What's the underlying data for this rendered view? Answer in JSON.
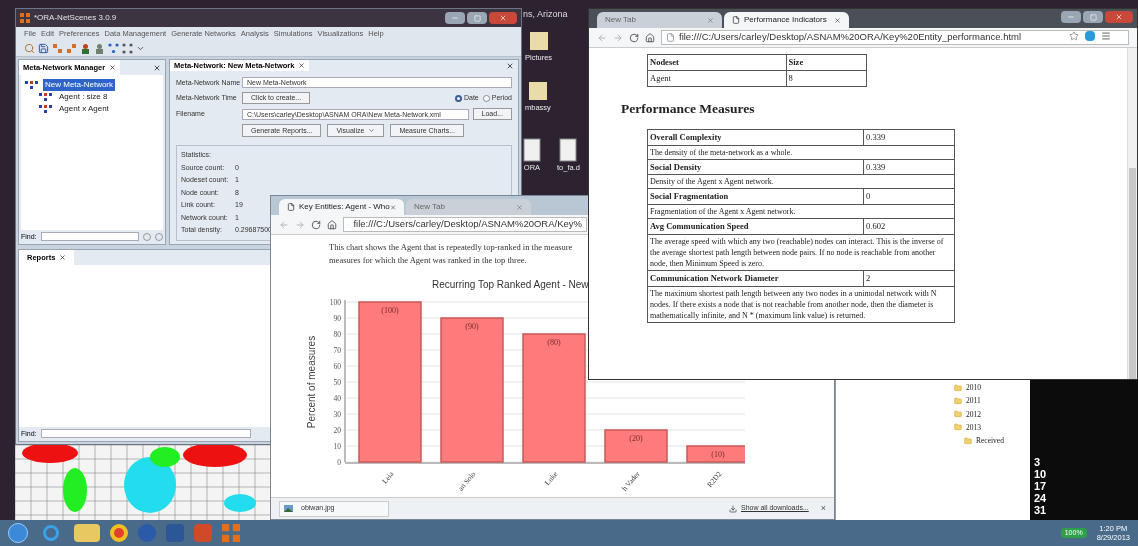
{
  "desktop": {
    "location_text": "ns, Arizona",
    "icons": [
      {
        "label": "Pictures"
      },
      {
        "label": "mbassy"
      },
      {
        "label": "ORA"
      },
      {
        "label": "to_fa.d"
      }
    ]
  },
  "ora_window": {
    "title": "*ORA-NetScenes 3.0.9",
    "menu": [
      "File",
      "Edit",
      "Preferences",
      "Data Management",
      "Generate Networks",
      "Analysis",
      "Simulations",
      "Visualizations",
      "Help"
    ],
    "manager_panel": {
      "tab": "Meta-Network Manager",
      "tree": [
        {
          "label": "New Meta-Network",
          "selected": true,
          "children": [
            {
              "label": "Agent : size 8",
              "selected": false
            },
            {
              "label": "Agent x Agent",
              "selected": false
            }
          ]
        }
      ],
      "find_label": "Find:"
    },
    "editor_panel": {
      "tab": "Meta-Network: New Meta-Network",
      "name_label": "Meta-Network Name",
      "name_value": "New Meta-Network",
      "time_label": "Meta-Network Time",
      "time_button": "Click to create...",
      "time_options": [
        {
          "label": "Date",
          "selected": true
        },
        {
          "label": "Period",
          "selected": false
        }
      ],
      "filename_label": "Filename",
      "filename_value": "C:\\Users\\carley\\Desktop\\ASNAM ORA\\New Meta-Network.xml",
      "load_button": "Load...",
      "actions": [
        "Generate Reports...",
        "Visualize",
        "Measure Charts..."
      ],
      "statistics_title": "Statistics:",
      "statistics": [
        {
          "label": "Source count:",
          "value": "0"
        },
        {
          "label": "Nodeset count:",
          "value": "1"
        },
        {
          "label": "Node count:",
          "value": "8"
        },
        {
          "label": "Link count:",
          "value": "19"
        },
        {
          "label": "Network count:",
          "value": "1"
        },
        {
          "label": "Total density:",
          "value": "0.29687500"
        }
      ]
    },
    "reports_panel": {
      "tab": "Reports",
      "find_label": "Find:"
    }
  },
  "key_entities_browser": {
    "tabs": [
      {
        "label": "Key Entities: Agent - Who",
        "selected": true
      },
      {
        "label": "New Tab",
        "selected": false
      }
    ],
    "url": "file:///C:/Users/carley/Desktop/ASNAM%20ORA/Key%",
    "intro": [
      "This chart shows the Agent that is repeatedly top-ranked in the measure",
      "measures for which the Agent was ranked in the top three."
    ],
    "chart_data": {
      "type": "bar",
      "title": "Recurring Top Ranked Agent - New",
      "ylabel": "Percent of measures",
      "categories": [
        "Leia",
        "an Solo",
        "Luke",
        "h Vader",
        "R2D2"
      ],
      "values": [
        100,
        90,
        80,
        20,
        10
      ],
      "ylim": [
        0,
        100
      ],
      "yticks": [
        0,
        10,
        20,
        30,
        40,
        50,
        60,
        70,
        80,
        90,
        100
      ],
      "grid": true,
      "value_labels": [
        "(100)",
        "(90)",
        "(80)",
        "(20)",
        "(10)"
      ]
    },
    "download": {
      "file": "obiwan.jpg",
      "show_all": "Show all downloads...",
      "close": "×"
    }
  },
  "performance_browser": {
    "tabs": [
      {
        "label": "New Tab",
        "selected": false
      },
      {
        "label": "Performance Indicators",
        "selected": true
      }
    ],
    "url": "file:///C:/Users/carley/Desktop/ASNAM%20ORA/Key%20Entity_performance.html",
    "nodeset_table": {
      "columns": [
        "Nodeset",
        "Size"
      ],
      "rows": [
        [
          "Agent",
          "8"
        ]
      ]
    },
    "heading": "Performance Measures",
    "measures": [
      {
        "name": "Overall Complexity",
        "value": "0.339",
        "description": "The density of the meta-network as a whole."
      },
      {
        "name": "Social Density",
        "value": "0.339",
        "description": "Density of the Agent x Agent network."
      },
      {
        "name": "Social Fragmentation",
        "value": "0",
        "description": "Fragmentation of the Agent x Agent network."
      },
      {
        "name": "Avg Communication Speed",
        "value": "0.602",
        "description": "The average speed with which any two (reachable) nodes can interact. This is the inverse of the average shortest path length between node pairs. If no node is reachable from another node, then Minimum Speed is zero."
      },
      {
        "name": "Communication Network Diameter",
        "value": "2",
        "description": "The maximum shortest path length between any two nodes in a unimodal network with N nodes. If there exists a node that is not reachable from another node, then the diameter is mathematically infinite, and N * (maximum link value) is returned."
      }
    ]
  },
  "mail_folders": [
    {
      "label": "2010"
    },
    {
      "label": "2011"
    },
    {
      "label": "2012"
    },
    {
      "label": "2013",
      "children": [
        {
          "label": "Received"
        }
      ]
    }
  ],
  "calendar_days": [
    "3",
    "10",
    "17",
    "24",
    "31"
  ],
  "taskbar": {
    "zoom_badge": "100%",
    "time": "1:20 PM",
    "date": "8/29/2013"
  }
}
